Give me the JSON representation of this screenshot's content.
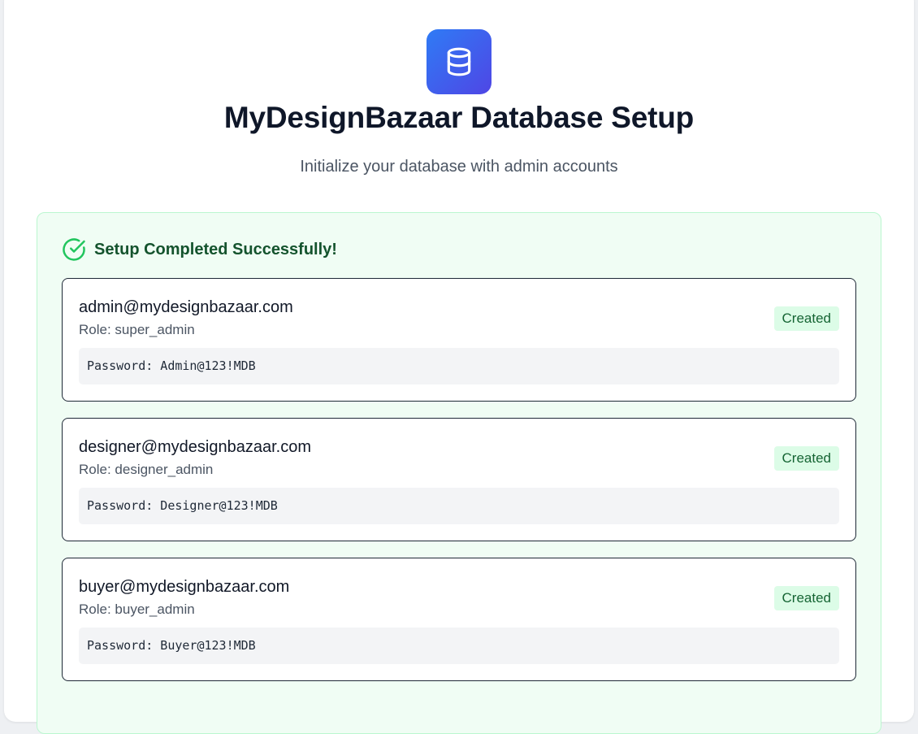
{
  "header": {
    "logo_icon": "database-icon",
    "title": "MyDesignBazaar Database Setup",
    "subtitle": "Initialize your database with admin accounts"
  },
  "result": {
    "status_icon": "check-circle-icon",
    "title": "Setup Completed Successfully!",
    "accounts": [
      {
        "email": "admin@mydesignbazaar.com",
        "role": "Role: super_admin",
        "status": "Created",
        "password": "Password: Admin@123!MDB"
      },
      {
        "email": "designer@mydesignbazaar.com",
        "role": "Role: designer_admin",
        "status": "Created",
        "password": "Password: Designer@123!MDB"
      },
      {
        "email": "buyer@mydesignbazaar.com",
        "role": "Role: buyer_admin",
        "status": "Created",
        "password": "Password: Buyer@123!MDB"
      }
    ]
  },
  "colors": {
    "brand_gradient_start": "#2f7bf5",
    "brand_gradient_end": "#4f46e5",
    "success_green": "#22c55e",
    "success_text": "#14532d",
    "badge_bg": "#dcfce7",
    "badge_text": "#166534"
  }
}
